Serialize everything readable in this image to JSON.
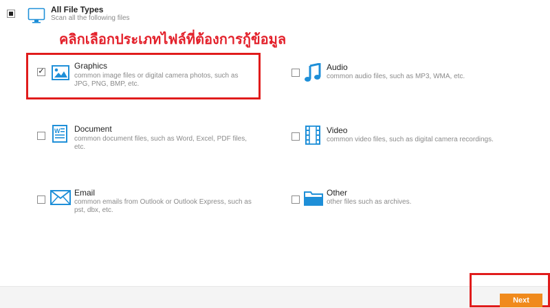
{
  "header": {
    "title": "All File Types",
    "subtitle": "Scan all the following files",
    "icon": "monitor-icon"
  },
  "instruction": "คลิกเลือกประเภทไฟล์ที่ต้องการกู้ข้อมูล",
  "file_types": [
    {
      "key": "graphics",
      "title": "Graphics",
      "desc_lines": [
        "common image files or digital camera photos, such as",
        "JPG, PNG, BMP, etc."
      ],
      "checked": true,
      "icon": "image-icon"
    },
    {
      "key": "audio",
      "title": "Audio",
      "desc_lines": [
        "common audio files, such as MP3, WMA, etc."
      ],
      "checked": false,
      "icon": "music-note-icon"
    },
    {
      "key": "document",
      "title": "Document",
      "desc_lines": [
        "common document files, such as Word, Excel, PDF files,",
        "etc."
      ],
      "checked": false,
      "icon": "document-icon"
    },
    {
      "key": "video",
      "title": "Video",
      "desc_lines": [
        "common video files, such as digital camera recordings."
      ],
      "checked": false,
      "icon": "film-icon"
    },
    {
      "key": "email",
      "title": "Email",
      "desc_lines": [
        "common emails from Outlook or Outlook Express, such as",
        "pst, dbx, etc."
      ],
      "checked": false,
      "icon": "envelope-icon"
    },
    {
      "key": "other",
      "title": "Other",
      "desc_lines": [
        "other files such as archives."
      ],
      "checked": false,
      "icon": "folder-icon"
    }
  ],
  "footer": {
    "next_label": "Next"
  },
  "colors": {
    "accent_blue": "#1e8fd8",
    "annotation_red": "#e01b1b",
    "next_orange": "#f08a1c",
    "instruction_red": "#e3202a"
  }
}
